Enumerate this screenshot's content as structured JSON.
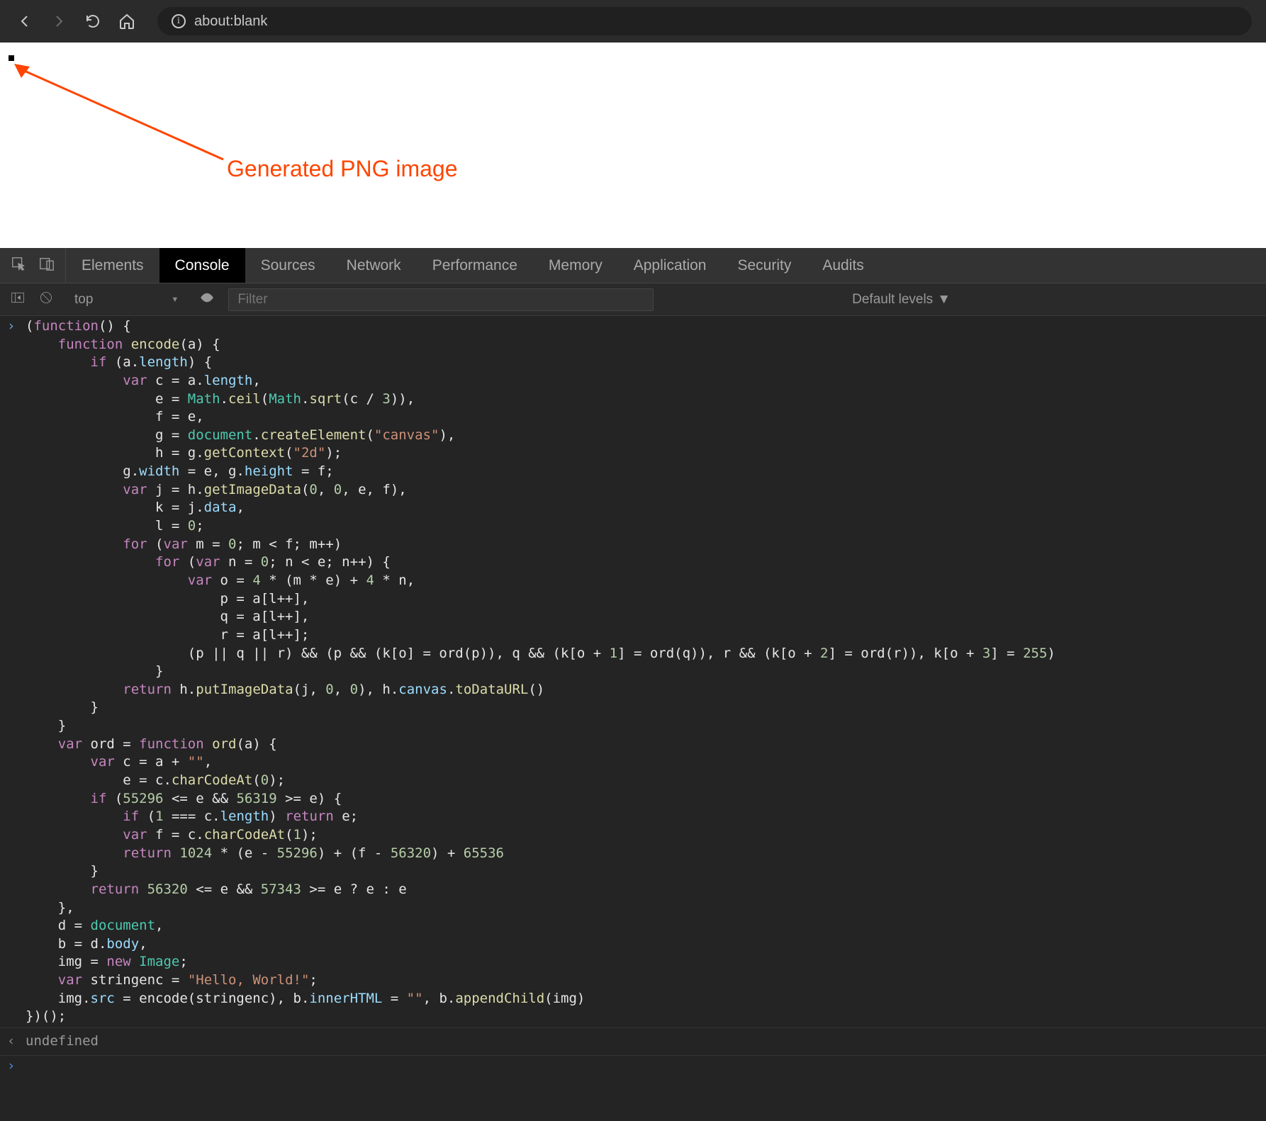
{
  "browser": {
    "url": "about:blank"
  },
  "annotation": {
    "label": "Generated PNG image"
  },
  "devtools": {
    "tabs": [
      "Elements",
      "Console",
      "Sources",
      "Network",
      "Performance",
      "Memory",
      "Application",
      "Security",
      "Audits"
    ],
    "activeTab": "Console",
    "console": {
      "context": "top",
      "filterPlaceholder": "Filter",
      "levels": "Default levels",
      "inputCode": "(function() {\n    function encode(a) {\n        if (a.length) {\n            var c = a.length,\n                e = Math.ceil(Math.sqrt(c / 3)),\n                f = e,\n                g = document.createElement(\"canvas\"),\n                h = g.getContext(\"2d\");\n            g.width = e, g.height = f;\n            var j = h.getImageData(0, 0, e, f),\n                k = j.data,\n                l = 0;\n            for (var m = 0; m < f; m++)\n                for (var n = 0; n < e; n++) {\n                    var o = 4 * (m * e) + 4 * n,\n                        p = a[l++],\n                        q = a[l++],\n                        r = a[l++];\n                    (p || q || r) && (p && (k[o] = ord(p)), q && (k[o + 1] = ord(q)), r && (k[o + 2] = ord(r)), k[o + 3] = 255)\n                }\n            return h.putImageData(j, 0, 0), h.canvas.toDataURL()\n        }\n    }\n    var ord = function ord(a) {\n        var c = a + \"\",\n            e = c.charCodeAt(0);\n        if (55296 <= e && 56319 >= e) {\n            if (1 === c.length) return e;\n            var f = c.charCodeAt(1);\n            return 1024 * (e - 55296) + (f - 56320) + 65536\n        }\n        return 56320 <= e && 57343 >= e ? e : e\n    },\n    d = document,\n    b = d.body,\n    img = new Image;\n    var stringenc = \"Hello, World!\";\n    img.src = encode(stringenc), b.innerHTML = \"\", b.appendChild(img)\n})();",
      "result": "undefined"
    }
  }
}
